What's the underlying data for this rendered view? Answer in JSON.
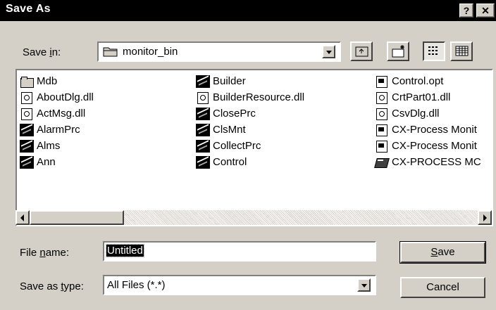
{
  "window": {
    "title": "Save As",
    "help_btn": "?",
    "close_btn": "✕"
  },
  "save_in": {
    "label_prefix": "Save ",
    "label_u": "i",
    "label_suffix": "n:",
    "value": "monitor_bin"
  },
  "toolbar": {
    "up_icon": "up-folder-icon",
    "new_folder_icon": "new-folder-icon",
    "list_icon": "list-view-icon",
    "details_icon": "details-view-icon"
  },
  "files": {
    "col1": [
      {
        "name": "Mdb",
        "icon": "folder"
      },
      {
        "name": "AboutDlg.dll",
        "icon": "dll"
      },
      {
        "name": "ActMsg.dll",
        "icon": "dll"
      },
      {
        "name": "AlarmPrc",
        "icon": "exe"
      },
      {
        "name": "Alms",
        "icon": "exe"
      },
      {
        "name": "Ann",
        "icon": "exe"
      }
    ],
    "col2": [
      {
        "name": "Builder",
        "icon": "exe"
      },
      {
        "name": "BuilderResource.dll",
        "icon": "dll"
      },
      {
        "name": "ClosePrc",
        "icon": "exe"
      },
      {
        "name": "ClsMnt",
        "icon": "exe"
      },
      {
        "name": "CollectPrc",
        "icon": "exe"
      },
      {
        "name": "Control",
        "icon": "exe"
      }
    ],
    "col3": [
      {
        "name": "Control.opt",
        "icon": "doc"
      },
      {
        "name": "CrtPart01.dll",
        "icon": "dll"
      },
      {
        "name": "CsvDlg.dll",
        "icon": "dll"
      },
      {
        "name": "CX-Process Monit",
        "icon": "doc"
      },
      {
        "name": "CX-Process Monit",
        "icon": "doc"
      },
      {
        "name": "CX-PROCESS MC",
        "icon": "book"
      }
    ]
  },
  "file_name": {
    "label_prefix": "File ",
    "label_u": "n",
    "label_suffix": "ame:",
    "value": "Untitled"
  },
  "save_type": {
    "label_prefix": "Save as ",
    "label_u": "t",
    "label_suffix": "ype:",
    "value": "All Files (*.*)"
  },
  "buttons": {
    "save_u": "S",
    "save_rest": "ave",
    "cancel": "Cancel"
  }
}
